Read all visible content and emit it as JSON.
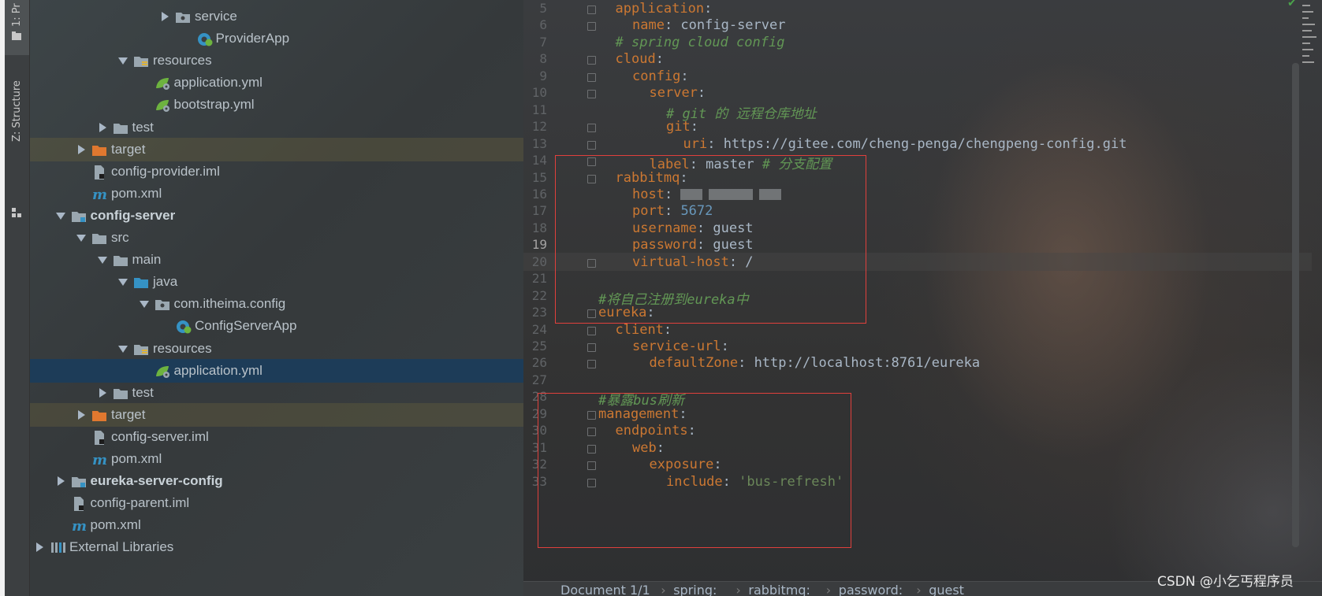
{
  "toolwindow_tabs": {
    "project_label": "1: Pr",
    "structure_label": "Z: Structure"
  },
  "tree": {
    "rows": [
      {
        "label": "service",
        "bold": false,
        "arrow": "collapsed",
        "icon": "package-icon"
      },
      {
        "label": "ProviderApp",
        "bold": false,
        "arrow": "none",
        "icon": "spring-boot-class-icon"
      },
      {
        "label": "resources",
        "bold": false,
        "arrow": "expanded",
        "icon": "resources-folder-icon"
      },
      {
        "label": "application.yml",
        "bold": false,
        "arrow": "none",
        "icon": "spring-yaml-icon"
      },
      {
        "label": "bootstrap.yml",
        "bold": false,
        "arrow": "none",
        "icon": "spring-yaml-icon"
      },
      {
        "label": "test",
        "bold": false,
        "arrow": "collapsed",
        "icon": "folder-icon"
      },
      {
        "label": "target",
        "bold": false,
        "arrow": "collapsed",
        "icon": "excluded-folder-icon"
      },
      {
        "label": "config-provider.iml",
        "bold": false,
        "arrow": "none",
        "icon": "iml-file-icon"
      },
      {
        "label": "pom.xml",
        "bold": false,
        "arrow": "none",
        "icon": "maven-icon"
      },
      {
        "label": "config-server",
        "bold": true,
        "arrow": "expanded",
        "icon": "module-folder-icon"
      },
      {
        "label": "src",
        "bold": false,
        "arrow": "expanded",
        "icon": "folder-icon"
      },
      {
        "label": "main",
        "bold": false,
        "arrow": "expanded",
        "icon": "folder-icon"
      },
      {
        "label": "java",
        "bold": false,
        "arrow": "expanded",
        "icon": "source-folder-icon"
      },
      {
        "label": "com.itheima.config",
        "bold": false,
        "arrow": "expanded",
        "icon": "package-icon"
      },
      {
        "label": "ConfigServerApp",
        "bold": false,
        "arrow": "none",
        "icon": "spring-boot-class-icon"
      },
      {
        "label": "resources",
        "bold": false,
        "arrow": "expanded",
        "icon": "resources-folder-icon"
      },
      {
        "label": "application.yml",
        "bold": false,
        "arrow": "none",
        "icon": "spring-yaml-icon"
      },
      {
        "label": "test",
        "bold": false,
        "arrow": "collapsed",
        "icon": "folder-icon"
      },
      {
        "label": "target",
        "bold": false,
        "arrow": "collapsed",
        "icon": "excluded-folder-icon"
      },
      {
        "label": "config-server.iml",
        "bold": false,
        "arrow": "none",
        "icon": "iml-file-icon"
      },
      {
        "label": "pom.xml",
        "bold": false,
        "arrow": "none",
        "icon": "maven-icon"
      },
      {
        "label": "eureka-server-config",
        "bold": true,
        "arrow": "collapsed",
        "icon": "module-folder-icon"
      },
      {
        "label": "config-parent.iml",
        "bold": false,
        "arrow": "none",
        "icon": "iml-file-icon"
      },
      {
        "label": "pom.xml",
        "bold": false,
        "arrow": "none",
        "icon": "maven-icon"
      },
      {
        "label": "External Libraries",
        "bold": false,
        "arrow": "collapsed",
        "icon": "libraries-icon"
      }
    ],
    "selected_index": 16,
    "excluded_indices": [
      6,
      18
    ]
  },
  "editor": {
    "current_line": 19,
    "lines": [
      {
        "no": "5",
        "tokens": [
          [
            "k",
            "application"
          ],
          [
            "v",
            ":"
          ]
        ]
      },
      {
        "no": "6",
        "tokens": [
          [
            "k",
            "name"
          ],
          [
            "v",
            ": config-server"
          ]
        ]
      },
      {
        "no": "7",
        "tokens": [
          [
            "c",
            "# spring cloud config"
          ]
        ]
      },
      {
        "no": "8",
        "tokens": [
          [
            "k",
            "cloud"
          ],
          [
            "v",
            ":"
          ]
        ]
      },
      {
        "no": "9",
        "tokens": [
          [
            "k",
            "config"
          ],
          [
            "v",
            ":"
          ]
        ]
      },
      {
        "no": "10",
        "tokens": [
          [
            "k",
            "server"
          ],
          [
            "v",
            ":"
          ]
        ]
      },
      {
        "no": "11",
        "tokens": [
          [
            "c",
            "# git 的 远程仓库地址"
          ]
        ]
      },
      {
        "no": "12",
        "tokens": [
          [
            "k",
            "git"
          ],
          [
            "v",
            ":"
          ]
        ]
      },
      {
        "no": "13",
        "tokens": [
          [
            "k",
            "uri"
          ],
          [
            "v",
            ": https://gitee.com/cheng-penga/chengpeng-config.git"
          ]
        ]
      },
      {
        "no": "14",
        "tokens": [
          [
            "k",
            "label"
          ],
          [
            "v",
            ": master "
          ],
          [
            "c",
            "# 分支配置"
          ]
        ]
      },
      {
        "no": "15",
        "tokens": [
          [
            "k",
            "rabbitmq"
          ],
          [
            "v",
            ":"
          ]
        ]
      },
      {
        "no": "16",
        "tokens": [
          [
            "k",
            "host"
          ],
          [
            "v",
            ": "
          ]
        ]
      },
      {
        "no": "17",
        "tokens": [
          [
            "k",
            "port"
          ],
          [
            "v",
            ": "
          ],
          [
            "n",
            "5672"
          ]
        ]
      },
      {
        "no": "18",
        "tokens": [
          [
            "k",
            "username"
          ],
          [
            "v",
            ": guest"
          ]
        ]
      },
      {
        "no": "19",
        "tokens": [
          [
            "k",
            "password"
          ],
          [
            "v",
            ": guest"
          ]
        ]
      },
      {
        "no": "20",
        "tokens": [
          [
            "k",
            "virtual-host"
          ],
          [
            "v",
            ": /"
          ]
        ]
      },
      {
        "no": "21",
        "tokens": []
      },
      {
        "no": "22",
        "tokens": [
          [
            "c",
            "#将自己注册到eureka中"
          ]
        ]
      },
      {
        "no": "23",
        "tokens": [
          [
            "k",
            "eureka"
          ],
          [
            "v",
            ":"
          ]
        ]
      },
      {
        "no": "24",
        "tokens": [
          [
            "k",
            "client"
          ],
          [
            "v",
            ":"
          ]
        ]
      },
      {
        "no": "25",
        "tokens": [
          [
            "k",
            "service-url"
          ],
          [
            "v",
            ":"
          ]
        ]
      },
      {
        "no": "26",
        "tokens": [
          [
            "k",
            "defaultZone"
          ],
          [
            "v",
            ": http://localhost:8761/eureka"
          ]
        ]
      },
      {
        "no": "27",
        "tokens": []
      },
      {
        "no": "28",
        "tokens": [
          [
            "c",
            "#暴露bus刷新"
          ]
        ]
      },
      {
        "no": "29",
        "tokens": [
          [
            "k",
            "management"
          ],
          [
            "v",
            ":"
          ]
        ]
      },
      {
        "no": "30",
        "tokens": [
          [
            "k",
            "endpoints"
          ],
          [
            "v",
            ":"
          ]
        ]
      },
      {
        "no": "31",
        "tokens": [
          [
            "k",
            "web"
          ],
          [
            "v",
            ":"
          ]
        ]
      },
      {
        "no": "32",
        "tokens": [
          [
            "k",
            "exposure"
          ],
          [
            "v",
            ":"
          ]
        ]
      },
      {
        "no": "33",
        "tokens": [
          [
            "k",
            "include"
          ],
          [
            "v",
            ": "
          ],
          [
            "s",
            "'bus-refresh'"
          ]
        ]
      }
    ]
  },
  "breadcrumb": {
    "items": [
      "Document 1/1",
      "spring:",
      "rabbitmq:",
      "password:",
      "guest"
    ]
  },
  "watermark": "CSDN @小乞丐程序员"
}
